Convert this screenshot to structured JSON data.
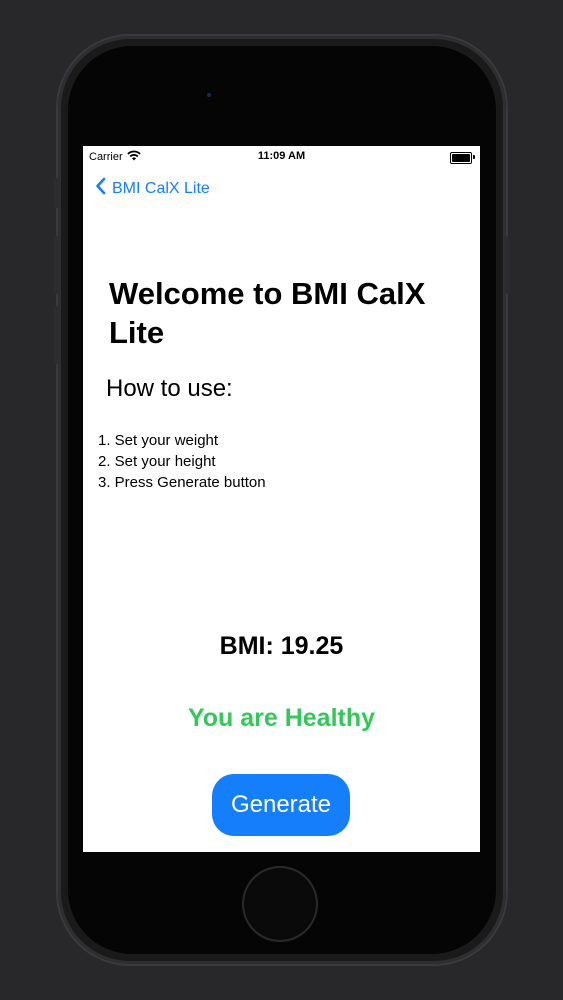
{
  "status_bar": {
    "carrier": "Carrier",
    "time": "11:09 AM"
  },
  "nav": {
    "back_label": "BMI CalX Lite"
  },
  "content": {
    "welcome_title": "Welcome to BMI CalX Lite",
    "howto_title": "How to use:",
    "steps": [
      "1. Set your weight",
      "2. Set your height",
      "3. Press Generate button"
    ],
    "bmi_label": "BMI: 19.25",
    "bmi_status": "You are Healthy",
    "generate_label": "Generate"
  },
  "colors": {
    "accent": "#147efb",
    "healthy": "#34c759",
    "background": "#282729"
  },
  "icons": {
    "wifi": "wifi-icon",
    "battery": "battery-icon",
    "back": "chevron-left-icon"
  }
}
